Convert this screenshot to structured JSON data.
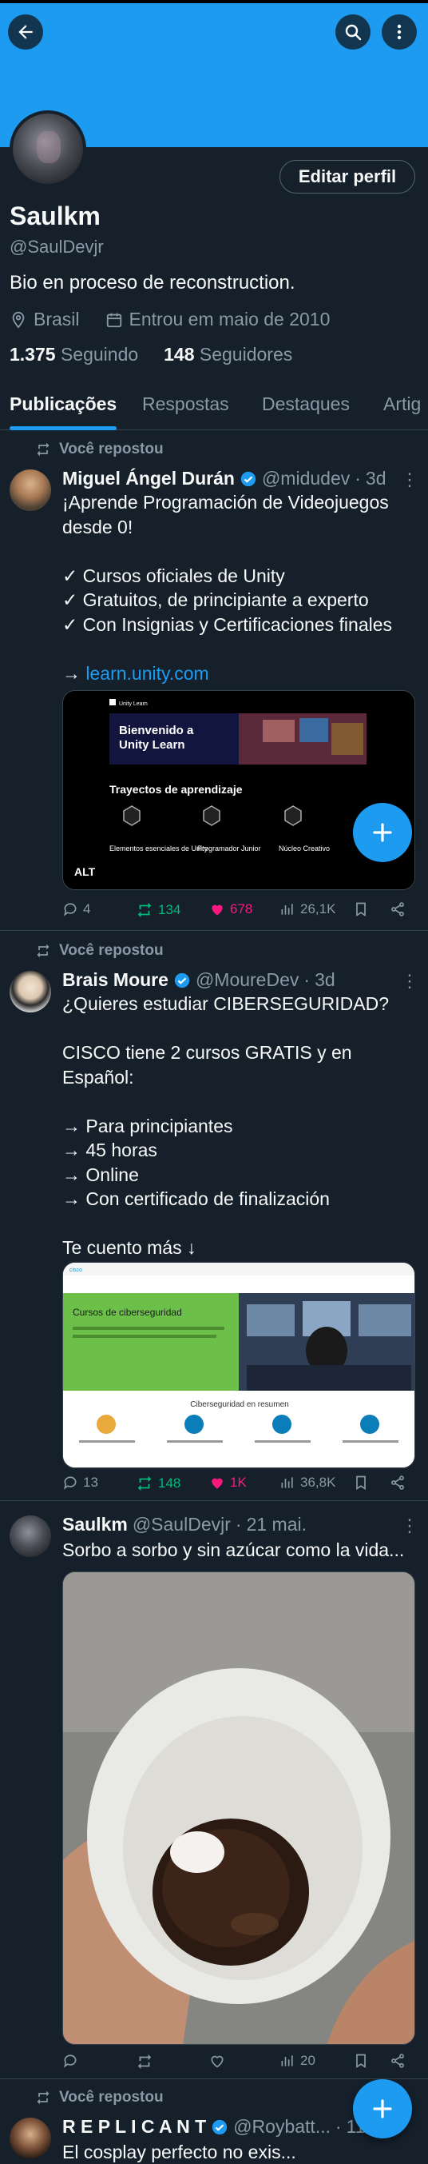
{
  "profile": {
    "name": "Saulkm",
    "handle": "@SaulDevjr",
    "bio": "Bio en proceso de reconstruction.",
    "location": "Brasil",
    "joined": "Entrou em maio de 2010",
    "following_count": "1.375",
    "following_label": "Seguindo",
    "followers_count": "148",
    "followers_label": "Seguidores",
    "edit_label": "Editar perfil"
  },
  "colors": {
    "accent": "#1d9bf0",
    "background": "#15202b",
    "retweet": "#00ba7c",
    "like": "#f91880"
  },
  "tabs": [
    {
      "label": "Publicações",
      "active": true
    },
    {
      "label": "Respostas"
    },
    {
      "label": "Destaques"
    },
    {
      "label": "Artig"
    }
  ],
  "posts": [
    {
      "repost_label": "Você repostou",
      "author": "Miguel Ángel Durán",
      "handle": "@midudev",
      "time": "3d",
      "lines_a": "¡Aprende Programación de Videojuegos desde 0!\n\n✓ Cursos oficiales de Unity\n✓ Gratuitos, de principiante a experto\n✓ Con Insignias y Certificaciones finales\n\n→ ",
      "link": "learn.unity.com",
      "card": {
        "brand": "Unity Learn",
        "headline": "Bienvenido a Unity Learn",
        "section": "Trayectos de aprendizaje",
        "items": [
          "Elementos esenciales de Unity",
          "Programador Junior",
          "Núcleo Creativo"
        ],
        "alt": "ALT"
      },
      "replies": "4",
      "reposts": "134",
      "likes": "678",
      "views": "26,1K"
    },
    {
      "repost_label": "Você repostou",
      "author": "Brais Moure",
      "handle": "@MoureDev",
      "time": "3d",
      "text": "¿Quieres estudiar CIBERSEGURIDAD?\n\nCISCO tiene 2 cursos GRATIS y en Español:\n\n→ Para principiantes\n→ 45 horas\n→ Online\n→ Con certificado de finalización\n\nTe cuento más ↓",
      "card": {
        "headline": "Cursos de ciberseguridad",
        "section": "Ciberseguridad en resumen"
      },
      "replies": "13",
      "reposts": "148",
      "likes": "1K",
      "views": "36,8K"
    },
    {
      "author": "Saulkm",
      "handle": "@SaulDevjr",
      "time": "21 mai.",
      "text": "Sorbo a sorbo y sin azúcar como la vida...",
      "views": "20"
    },
    {
      "repost_label": "Você repostou",
      "author": "R E P L I C A N T",
      "handle": "@Roybatt...",
      "time": "11",
      "text": "El cosplay perfecto no exis..."
    }
  ]
}
